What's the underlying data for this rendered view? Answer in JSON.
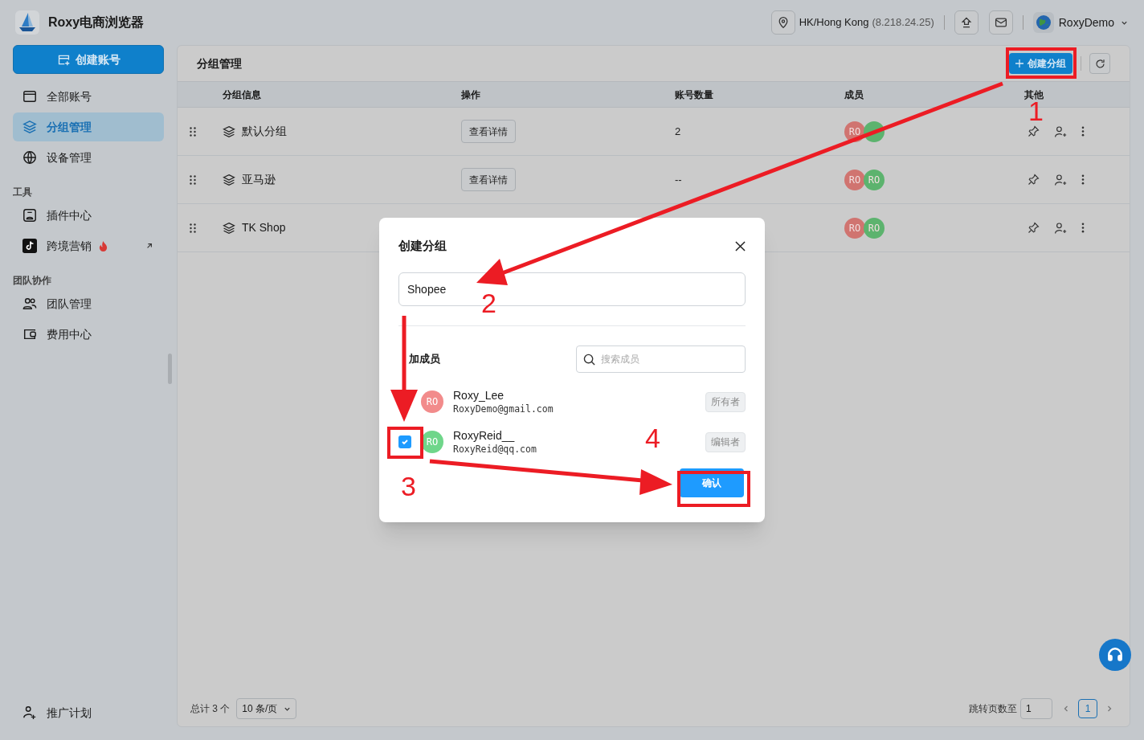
{
  "app": {
    "title": "Roxy电商浏览器"
  },
  "topbar": {
    "location": "HK/Hong Kong",
    "ip": "(8.218.24.25)",
    "user": "RoxyDemo"
  },
  "sidebar": {
    "create_button": "创建账号",
    "sections": [
      {
        "items": [
          {
            "label": "全部账号",
            "selected": false
          },
          {
            "label": "分组管理",
            "selected": true
          },
          {
            "label": "设备管理",
            "selected": false
          }
        ]
      },
      {
        "title": "工具",
        "items": [
          {
            "label": "插件中心",
            "selected": false,
            "hot": false,
            "external": false
          },
          {
            "label": "跨境营销",
            "selected": false,
            "hot": true,
            "external": true
          }
        ]
      },
      {
        "title": "团队协作",
        "items": [
          {
            "label": "团队管理",
            "selected": false
          },
          {
            "label": "费用中心",
            "selected": false
          }
        ]
      }
    ],
    "bottom_item": {
      "label": "推广计划"
    }
  },
  "page": {
    "title": "分组管理",
    "create_button": "创建分组"
  },
  "table": {
    "columns": [
      "分组信息",
      "操作",
      "账号数量",
      "成员",
      "其他"
    ],
    "rows": [
      {
        "name": "默认分组",
        "action": "查看详情",
        "count": "2",
        "members": [
          {
            "initials": "RO",
            "color": "#d07470"
          },
          {
            "color": "#5cb36e"
          }
        ]
      },
      {
        "name": "亚马逊",
        "action": "查看详情",
        "count": "--",
        "members": [
          {
            "initials": "RO",
            "color": "#d07470"
          },
          {
            "initials": "RO",
            "color": "#5cb36e"
          }
        ]
      },
      {
        "name": "TK Shop",
        "members": [
          {
            "initials": "RO",
            "color": "#d07470"
          },
          {
            "initials": "RO",
            "color": "#5cb36e"
          }
        ]
      }
    ]
  },
  "pagination": {
    "total": "总计 3 个",
    "page_size": "10 条/页",
    "jump_label": "跳转页数至",
    "jump_value": "1",
    "pages": [
      {
        "label": "1",
        "selected": true
      }
    ]
  },
  "dialog": {
    "title": "创建分组",
    "name_value": "Shopee",
    "members_label": "加成员",
    "search_placeholder": "搜索成员",
    "members": [
      {
        "initials": "RO",
        "color": "#f28b8b",
        "name": "Roxy_Lee",
        "email": "RoxyDemo@gmail.com",
        "role": "所有者"
      },
      {
        "initials": "RO",
        "color": "#6fd68a",
        "name": "RoxyReid__",
        "email": "RoxyReid@qq.com",
        "role": "编辑者",
        "checked": true
      }
    ],
    "confirm": "确认"
  },
  "annotations": [
    {
      "label": "1"
    },
    {
      "label": "2"
    },
    {
      "label": "3"
    },
    {
      "label": "4"
    }
  ]
}
